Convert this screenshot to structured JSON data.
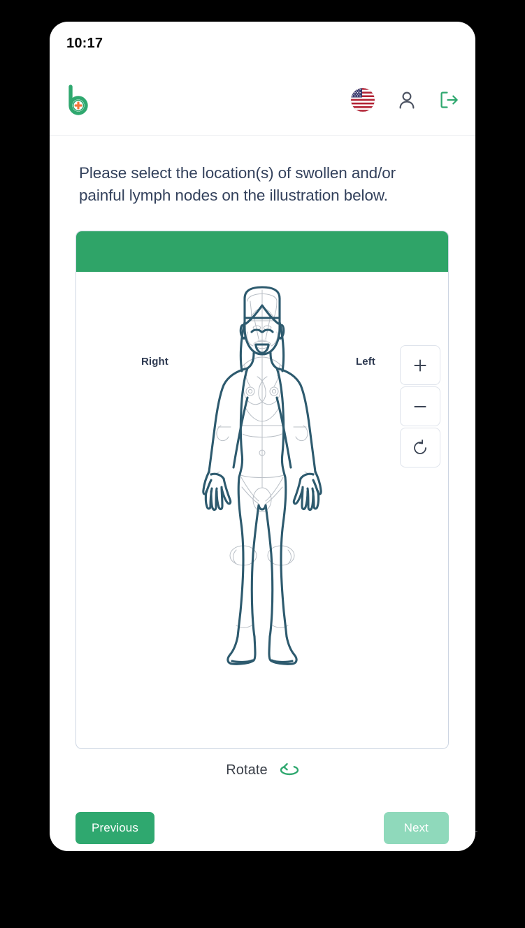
{
  "status_bar": {
    "time": "10:17"
  },
  "app_header": {
    "logo_name": "brand-logo-b-cross",
    "logo_colors": {
      "letter": "#2fa86f",
      "cross": "#f4763a"
    },
    "actions": [
      {
        "name": "language-flag-icon",
        "label": "US"
      },
      {
        "name": "user-account-icon",
        "label": "Account"
      },
      {
        "name": "logout-icon",
        "label": "Log out"
      }
    ]
  },
  "question": {
    "line1": "Please select the location(s) of swollen and/or",
    "line2": "painful lymph nodes on the illustration below."
  },
  "illustration": {
    "header_color": "#2fa468",
    "side_labels": {
      "right": "Right",
      "left": "Left"
    },
    "controls": [
      {
        "name": "zoom-in-button",
        "glyph": "+"
      },
      {
        "name": "zoom-out-button",
        "glyph": "−"
      },
      {
        "name": "reset-view-button",
        "glyph": "reset-icon"
      }
    ],
    "figure": {
      "name": "female-body-front-illustration",
      "outline_color": "#2d5a6e",
      "detail_color": "#b9bfc6",
      "view": "front"
    }
  },
  "rotate": {
    "label": "Rotate",
    "icon": "rotate-3d-icon",
    "icon_color": "#2fa86f"
  },
  "footer": {
    "previous": {
      "label": "Previous",
      "color": "#2fa86f",
      "enabled": true
    },
    "next": {
      "label": "Next",
      "color": "#8fd9bb",
      "enabled": false
    }
  }
}
